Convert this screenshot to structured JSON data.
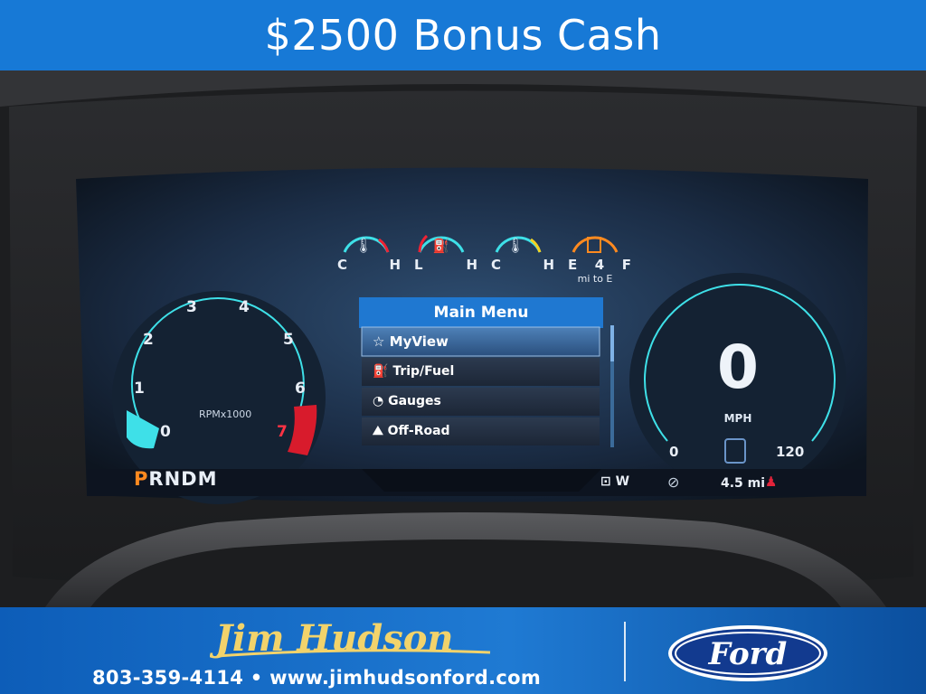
{
  "banner": {
    "headline": "$2500 Bonus Cash"
  },
  "cluster": {
    "gauges_small": [
      {
        "left": "C",
        "right": "H"
      },
      {
        "left": "L",
        "right": "H"
      },
      {
        "left": "C",
        "right": "H"
      },
      {
        "left": "E",
        "mid": "4",
        "right": "F",
        "sub": "mi to E"
      }
    ],
    "tach": {
      "ticks": [
        "0",
        "1",
        "2",
        "3",
        "4",
        "5",
        "6",
        "7"
      ],
      "unit": "RPMx1000"
    },
    "gear": {
      "active": "P",
      "rest": "RNDM"
    },
    "menu": {
      "title": "Main Menu",
      "items": [
        "MyView",
        "Trip/Fuel",
        "Gauges",
        "Off-Road"
      ]
    },
    "speedo": {
      "value": "0",
      "unit": "MPH",
      "min": "0",
      "max": "120"
    },
    "status": {
      "compass": "W",
      "range": "4.5 mi"
    }
  },
  "footer": {
    "signature": "Jim Hudson",
    "contact": "803-359-4114 • www.jimhudsonford.com",
    "brand": "Ford"
  },
  "colors": {
    "banner_blue": "#1779d6",
    "menu_blue": "#1f78d1",
    "gear_orange": "#ff8a1f",
    "tach_red": "#d81b2c",
    "accent_cyan": "#3ee0e8"
  }
}
